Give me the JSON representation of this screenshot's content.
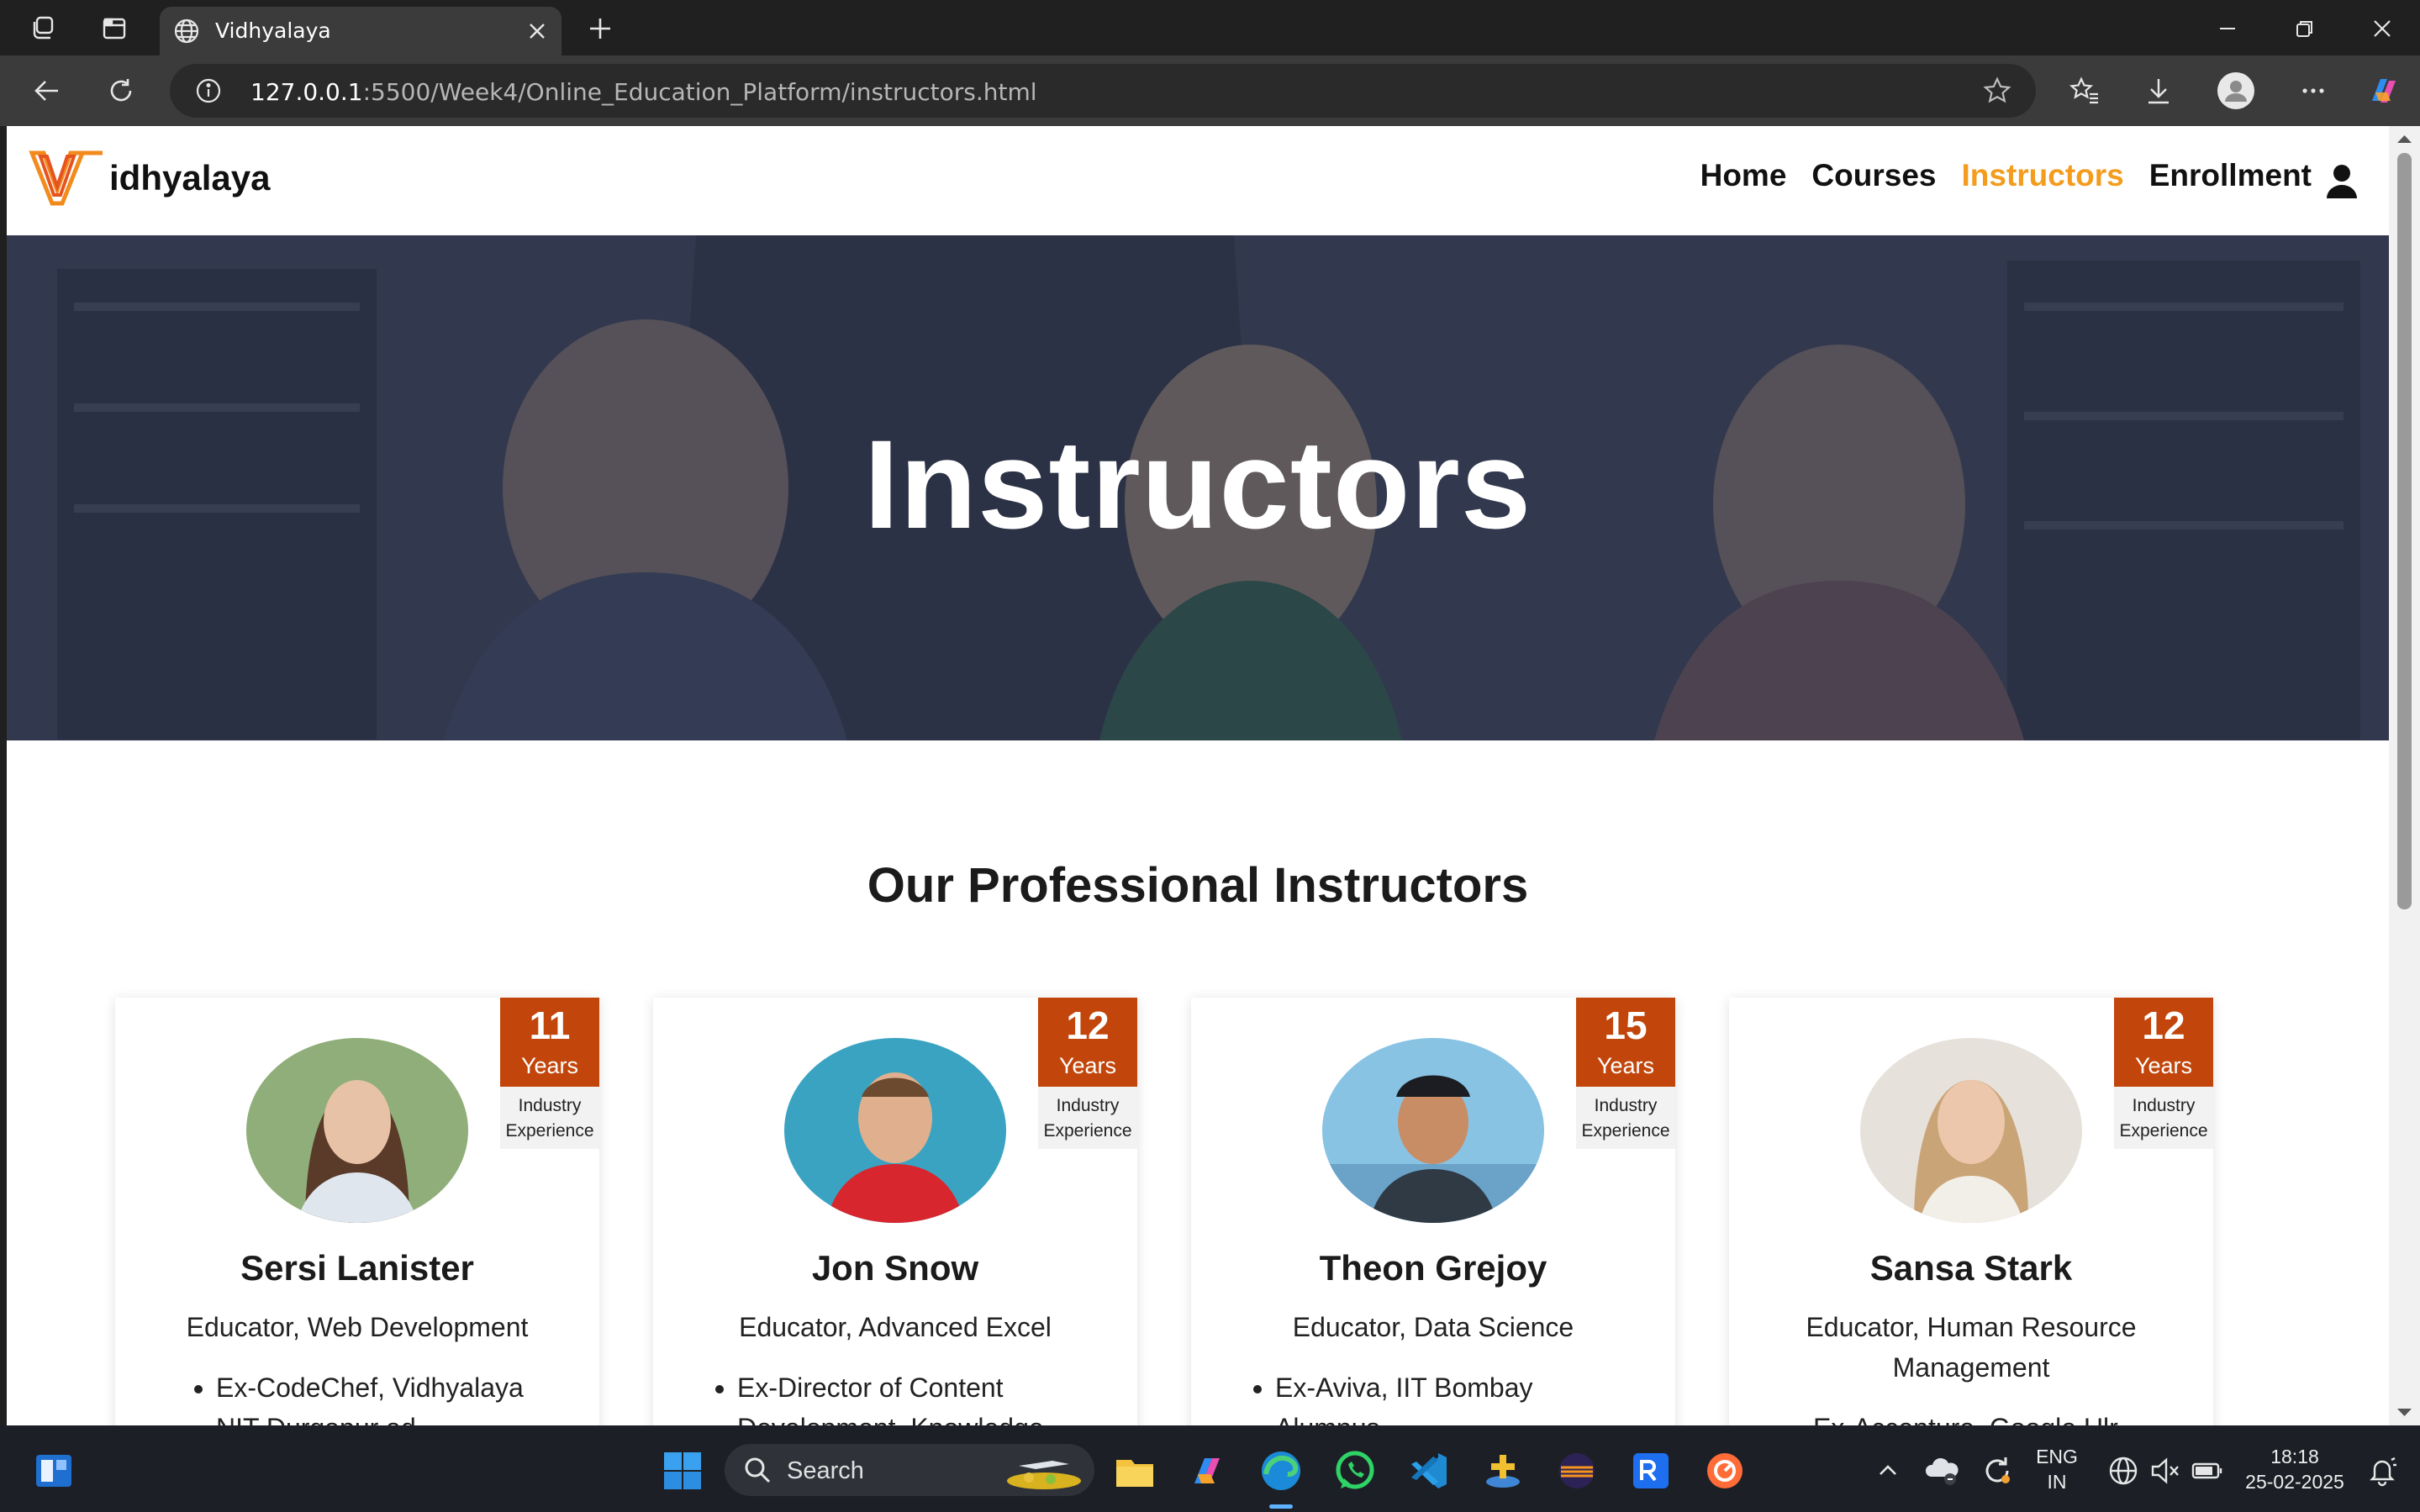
{
  "browser": {
    "tab_title": "Vidhyalaya",
    "address_host": "127.0.0.1",
    "address_rest": ":5500/Week4/Online_Education_Platform/instructors.html"
  },
  "site": {
    "logo_text": "idhyalaya",
    "nav": [
      "Home",
      "Courses",
      "Instructors",
      "Enrollment"
    ],
    "active_nav": "Instructors",
    "hero_title": "Instructors",
    "section_title": "Our Professional Instructors"
  },
  "instructors": [
    {
      "years": "11",
      "years_label": "Years",
      "exp_line1": "Industry",
      "exp_line2": "Experience",
      "name": "Sersi Lanister",
      "role": "Educator, Web Development",
      "bullets": [
        "Ex-CodeChef, Vidhyalaya",
        "NIT Durgapur ad..."
      ]
    },
    {
      "years": "12",
      "years_label": "Years",
      "exp_line1": "Industry",
      "exp_line2": "Experience",
      "name": "Jon Snow",
      "role": "Educator, Advanced Excel",
      "bullets": [
        "Ex-Director of Content",
        "Development, Knowledge"
      ]
    },
    {
      "years": "15",
      "years_label": "Years",
      "exp_line1": "Industry",
      "exp_line2": "Experience",
      "name": "Theon Grejoy",
      "role": "Educator, Data Science",
      "bullets": [
        "Ex-Aviva, IIT Bombay",
        "Alumnus"
      ]
    },
    {
      "years": "12",
      "years_label": "Years",
      "exp_line1": "Industry",
      "exp_line2": "Experience",
      "name": "Sansa Stark",
      "role": "Educator, Human Resource Management",
      "bullets": [
        "Ex-Accenture, Google Ulr..."
      ]
    }
  ],
  "taskbar": {
    "search_label": "Search",
    "lang_line1": "ENG",
    "lang_line2": "IN",
    "time": "18:18",
    "date": "25-02-2025"
  },
  "colors": {
    "accent": "#f39c1e",
    "badge": "#c2460b"
  }
}
